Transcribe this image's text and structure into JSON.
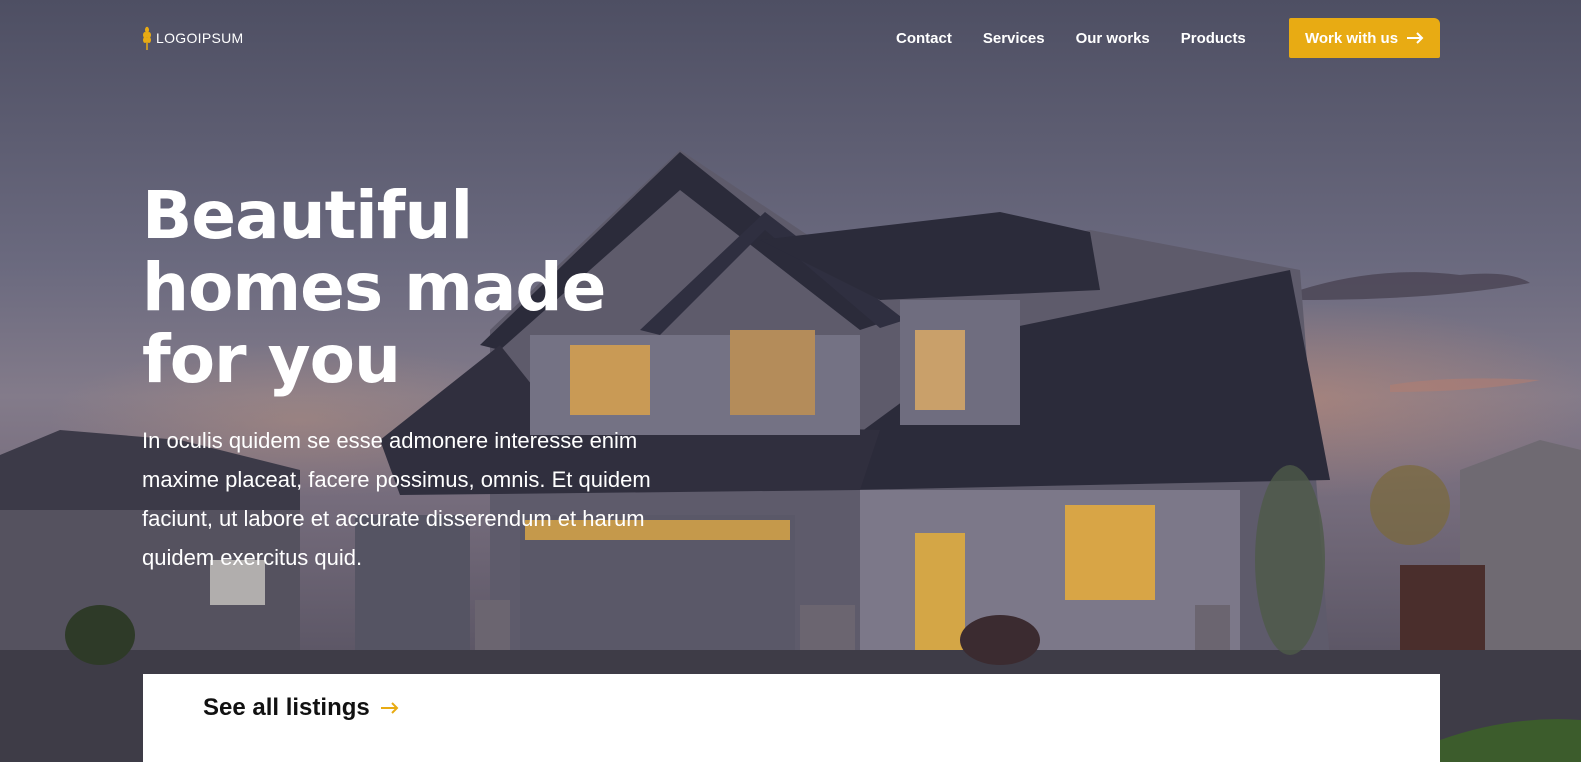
{
  "brand": {
    "logo_text": "LOGOIPSUM",
    "logo_icon": "wheat-icon"
  },
  "nav": {
    "links": [
      {
        "label": "Contact"
      },
      {
        "label": "Services"
      },
      {
        "label": "Our works"
      },
      {
        "label": "Products"
      }
    ],
    "cta_label": "Work with us",
    "cta_icon": "arrow-right-icon"
  },
  "hero": {
    "headline_lines": [
      "Beautiful",
      "homes made",
      "for you"
    ],
    "description": "In oculis quidem se esse admonere interesse enim maxime placeat, facere possimus, omnis. Et quidem faciunt, ut labore et accurate disserendum et harum quidem exercitus quid.",
    "background": "house-photo"
  },
  "listings": {
    "label": "See all listings",
    "icon": "arrow-right-icon"
  },
  "colors": {
    "accent": "#e8ab13",
    "text_on_dark": "#ffffff",
    "card_bg": "#ffffff",
    "card_text": "#111111"
  }
}
